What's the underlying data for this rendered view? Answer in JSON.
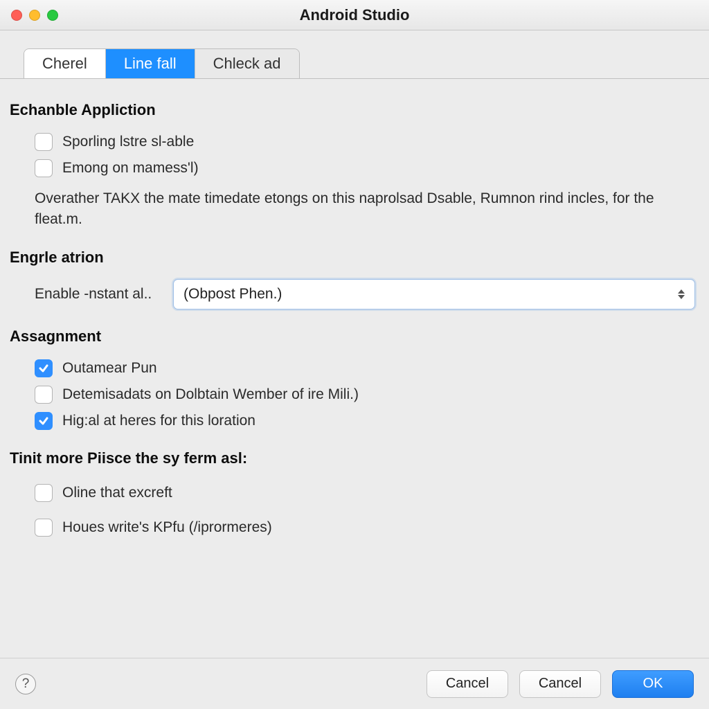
{
  "window": {
    "title": "Android Studio"
  },
  "tabs": [
    {
      "label": "Cherel"
    },
    {
      "label": "Line fall"
    },
    {
      "label": "Chleck ad"
    }
  ],
  "section1": {
    "heading": "Echanble Appliction",
    "cb1": {
      "label": "Sporling lstre sl-able",
      "checked": false
    },
    "cb2": {
      "label": "Emong on mamess'l)",
      "checked": false
    },
    "description": "Overather TAKX the mate timedate etongs on this naprolsad Dsable, Rumnon rind incles, for the fleat.m."
  },
  "section2": {
    "heading": "Engrle atrion",
    "select": {
      "label": "Enable -nstant al..",
      "value": "(Obpost Phen.)"
    }
  },
  "section3": {
    "heading": "Assagnment",
    "cb1": {
      "label": "Outamear Pun",
      "checked": true
    },
    "cb2": {
      "label": "Detemisadats on Dolbtain Wember of ire Mili.)",
      "checked": false
    },
    "cb3": {
      "label": "Hig:al at heres for this loration",
      "checked": true
    }
  },
  "section4": {
    "heading": "Tinit more Piisce the sy ferm asl:",
    "cb1": {
      "label": "Oline that excreft",
      "checked": false
    },
    "cb2": {
      "label": "Houes write's KPfu (/iprormeres)",
      "checked": false
    }
  },
  "footer": {
    "help": "?",
    "cancel1": "Cancel",
    "cancel2": "Cancel",
    "ok": "OK"
  }
}
